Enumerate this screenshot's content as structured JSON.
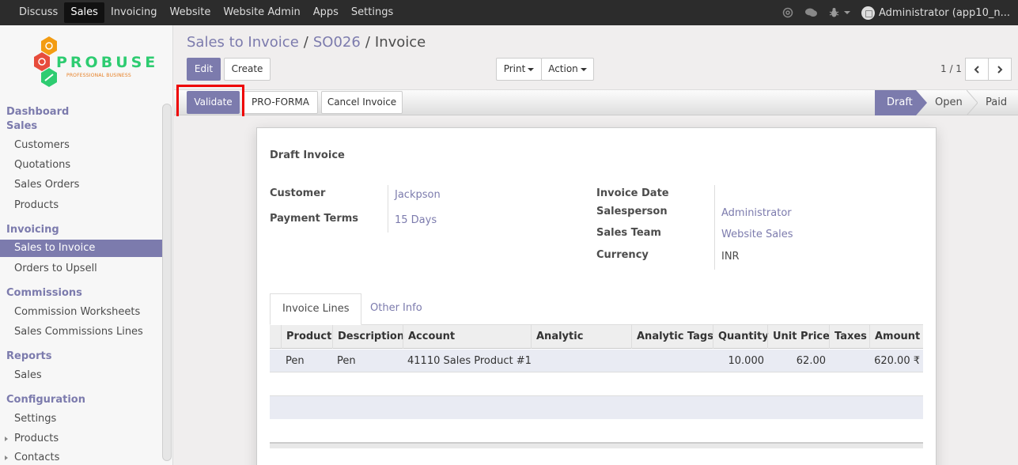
{
  "topnav": {
    "items": [
      "Discuss",
      "Sales",
      "Invoicing",
      "Website",
      "Website Admin",
      "Apps",
      "Settings"
    ],
    "active": "Sales",
    "user": "Administrator (app10_n..."
  },
  "sidebar": {
    "logo_text": "PROBUSE",
    "logo_tagline": "PROFESSIONAL BUSINESS",
    "sections": [
      {
        "head": "Dashboard"
      },
      {
        "head": "Sales",
        "items": [
          "Customers",
          "Quotations",
          "Sales Orders",
          "Products"
        ]
      },
      {
        "head": "Invoicing",
        "items": [
          "Sales to Invoice",
          "Orders to Upsell"
        ]
      },
      {
        "head": "Commissions",
        "items": [
          "Commission Worksheets",
          "Sales Commissions Lines"
        ]
      },
      {
        "head": "Reports",
        "items": [
          "Sales"
        ]
      },
      {
        "head": "Configuration",
        "items": [
          "Settings",
          "Products",
          "Contacts"
        ]
      }
    ],
    "active_item": "Sales to Invoice"
  },
  "breadcrumb": {
    "items": [
      "Sales to Invoice",
      "SO026",
      "Invoice"
    ],
    "separator": "/"
  },
  "buttons": {
    "edit": "Edit",
    "create": "Create",
    "print": "Print",
    "action": "Action",
    "validate": "Validate",
    "proforma": "PRO-FORMA",
    "cancel_invoice": "Cancel Invoice"
  },
  "pager": {
    "value": "1 / 1"
  },
  "stages": {
    "items": [
      "Draft",
      "Open",
      "Paid"
    ],
    "active": "Draft"
  },
  "invoice": {
    "title": "Draft Invoice",
    "customer_label": "Customer",
    "customer": "Jackpson",
    "payment_terms_label": "Payment Terms",
    "payment_terms": "15 Days",
    "invoice_date_label": "Invoice Date",
    "invoice_date": "",
    "salesperson_label": "Salesperson",
    "salesperson": "Administrator",
    "sales_team_label": "Sales Team",
    "sales_team": "Website Sales",
    "currency_label": "Currency",
    "currency": "INR"
  },
  "tabs": {
    "items": [
      "Invoice Lines",
      "Other Info"
    ],
    "active": "Invoice Lines"
  },
  "lines": {
    "columns": [
      "Product",
      "Description",
      "Account",
      "Analytic Account",
      "Analytic Tags",
      "Quantity",
      "Unit Price",
      "Taxes",
      "Amount"
    ],
    "rows": [
      {
        "product": "Pen",
        "description": "Pen",
        "account": "41110 Sales Product #1",
        "analytic_account": "",
        "analytic_tags": "",
        "quantity": "10.000",
        "unit_price": "62.00",
        "taxes": "",
        "amount": "620.00 ₹"
      }
    ]
  },
  "colors": {
    "accent": "#7c7bad",
    "navbar": "#2c2c2c",
    "highlight": "#ee0000"
  }
}
